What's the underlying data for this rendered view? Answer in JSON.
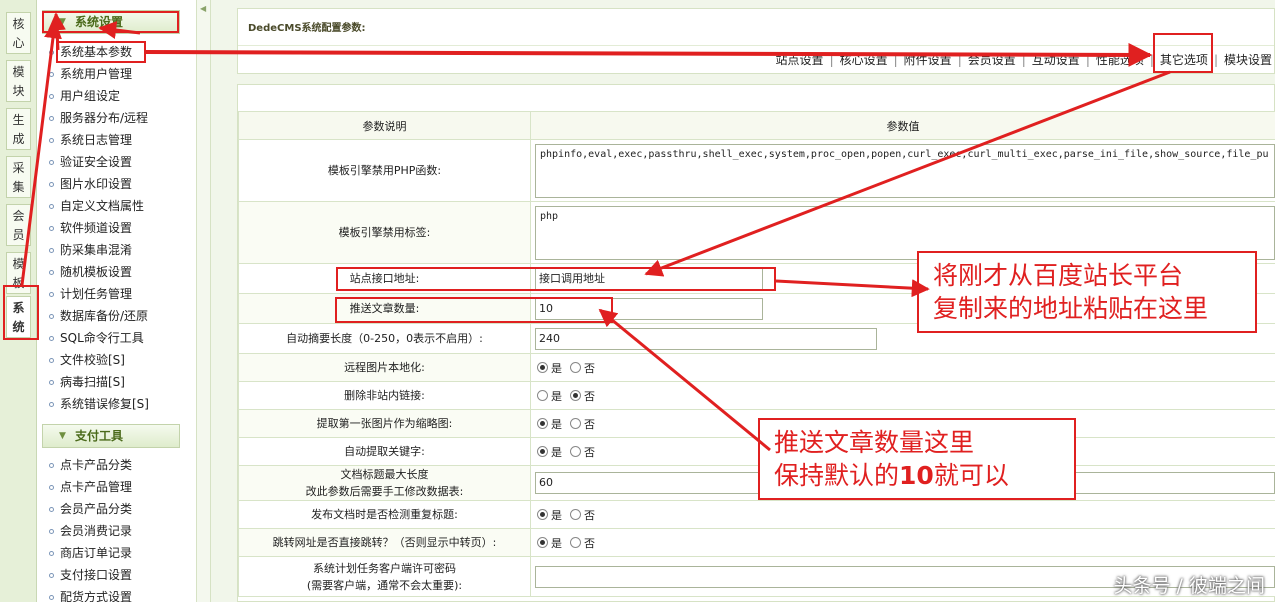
{
  "left_tabs": [
    "核心",
    "模块",
    "生成",
    "采集",
    "会员",
    "模板",
    "系统"
  ],
  "menu": {
    "section1": "系统设置",
    "items1": [
      "系统基本参数",
      "系统用户管理",
      "用户组设定",
      "服务器分布/远程",
      "系统日志管理",
      "验证安全设置",
      "图片水印设置",
      "自定义文档属性",
      "软件频道设置",
      "防采集串混淆",
      "随机模板设置",
      "计划任务管理",
      "数据库备份/还原",
      "SQL命令行工具",
      "文件校验[S]",
      "病毒扫描[S]",
      "系统错误修复[S]"
    ],
    "section2": "支付工具",
    "items2": [
      "点卡产品分类",
      "点卡产品管理",
      "会员产品分类",
      "会员消费记录",
      "商店订单记录",
      "支付接口设置",
      "配货方式设置"
    ]
  },
  "header": {
    "title": "DedeCMS系统配置参数:",
    "tabs": [
      "站点设置",
      "核心设置",
      "附件设置",
      "会员设置",
      "互动设置",
      "性能选项",
      "其它选项",
      "模块设置"
    ]
  },
  "table": {
    "col_desc": "参数说明",
    "col_value": "参数值",
    "rows": [
      {
        "label": "模板引擎禁用PHP函数:",
        "type": "textarea",
        "value": "phpinfo,eval,exec,passthru,shell_exec,system,proc_open,popen,curl_exec,curl_multi_exec,parse_ini_file,show_source,file_pu"
      },
      {
        "label": "模板引擎禁用标签:",
        "type": "textarea",
        "value": "php"
      },
      {
        "label": "站点接口地址:",
        "type": "input",
        "value": "接口调用地址"
      },
      {
        "label": "推送文章数量:",
        "type": "input",
        "value": "10"
      },
      {
        "label": "自动摘要长度（0-250，0表示不启用）:",
        "type": "input",
        "value": "240"
      },
      {
        "label": "远程图片本地化:",
        "type": "radio",
        "selected": "是"
      },
      {
        "label": "删除非站内链接:",
        "type": "radio",
        "selected": "否"
      },
      {
        "label": "提取第一张图片作为缩略图:",
        "type": "radio",
        "selected": "是"
      },
      {
        "label": "自动提取关键字:",
        "type": "radio",
        "selected": "是"
      },
      {
        "label": "文档标题最大长度",
        "label2": "改此参数后需要手工修改数据表:",
        "type": "input",
        "value": "60"
      },
      {
        "label": "发布文档时是否检测重复标题:",
        "type": "radio",
        "selected": "是"
      },
      {
        "label": "跳转网址是否直接跳转？（否则显示中转页）:",
        "type": "radio",
        "selected": "是"
      },
      {
        "label": "系统计划任务客户端许可密码",
        "label2": "(需要客户端，通常不会太重要):",
        "type": "input",
        "value": ""
      }
    ],
    "radio_yes": "是",
    "radio_no": "否"
  },
  "annotations": {
    "note1_line1": "将刚才从百度站长平台",
    "note1_line2": "复制来的地址粘贴在这里",
    "note2_line1": "推送文章数量这里",
    "note2_line2_pre": "保持默认的",
    "note2_line2_num": "10",
    "note2_line2_post": "就可以",
    "color": "#e02020"
  },
  "watermark": "头条号 / 彼端之间"
}
